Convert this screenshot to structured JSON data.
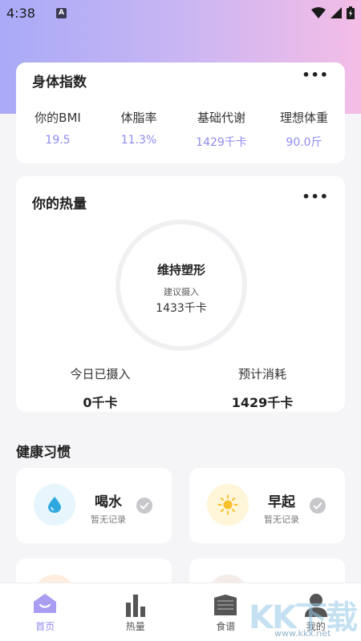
{
  "status_bar": {
    "time": "4:38",
    "notification_badge": "A"
  },
  "body_index": {
    "title": "身体指数",
    "more": "•••",
    "metrics": [
      {
        "label": "你的BMI",
        "value": "19.5"
      },
      {
        "label": "体脂率",
        "value": "11.3%"
      },
      {
        "label": "基础代谢",
        "value": "1429千卡"
      },
      {
        "label": "理想体重",
        "value": "90.0斤"
      }
    ]
  },
  "calories": {
    "title": "你的热量",
    "more": "•••",
    "ring": {
      "title": "维持塑形",
      "subtitle": "建议摄入",
      "value": "1433千卡"
    },
    "intake": {
      "label": "今日已摄入",
      "value": "0千卡"
    },
    "burn": {
      "label": "预计消耗",
      "value": "1429千卡"
    }
  },
  "habits": {
    "title": "健康习惯",
    "items": [
      {
        "name": "喝水",
        "status": "暂无记录",
        "icon": "water-drop-icon",
        "color": "#e6f6fc",
        "icon_color": "#2fa8e0"
      },
      {
        "name": "早起",
        "status": "暂无记录",
        "icon": "sun-icon",
        "color": "#fff5d8",
        "icon_color": "#f8c12c"
      }
    ]
  },
  "tab_bar": {
    "items": [
      {
        "label": "首页",
        "icon": "home-icon",
        "active": true
      },
      {
        "label": "热量",
        "icon": "bar-chart-icon",
        "active": false
      },
      {
        "label": "食谱",
        "icon": "recipe-book-icon",
        "active": false
      },
      {
        "label": "我的",
        "icon": "person-icon",
        "active": false
      }
    ]
  },
  "watermark": {
    "text": "KK下载",
    "url": "www.kkx.net"
  },
  "colors": {
    "accent": "#8f8cf0",
    "gradient_start": "#a9aaf7",
    "gradient_end": "#f4bde6"
  }
}
